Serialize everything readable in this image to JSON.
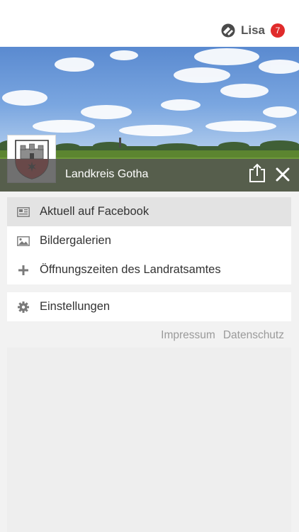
{
  "header": {
    "user_name": "Lisa",
    "notification_count": "7",
    "logo_icon": "app-logo-icon"
  },
  "banner": {
    "title": "Landkreis Gotha",
    "crest_icon": "coat-of-arms-icon",
    "share_icon": "share-icon",
    "close_icon": "close-icon"
  },
  "menu": {
    "items": [
      {
        "label": "Aktuell auf Facebook",
        "icon": "newspaper-icon",
        "active": true
      },
      {
        "label": "Bildergalerien",
        "icon": "image-icon",
        "active": false
      },
      {
        "label": "Öffnungszeiten des Landratsamtes",
        "icon": "plus-icon",
        "active": false
      }
    ]
  },
  "settings": {
    "label": "Einstellungen",
    "icon": "gear-icon"
  },
  "footer": {
    "links": [
      "Impressum",
      "Datenschutz"
    ]
  },
  "colors": {
    "badge": "#e02b2b",
    "active_item": "#e3e3e3",
    "titlebar": "#505050",
    "crest_red": "#d62828"
  }
}
